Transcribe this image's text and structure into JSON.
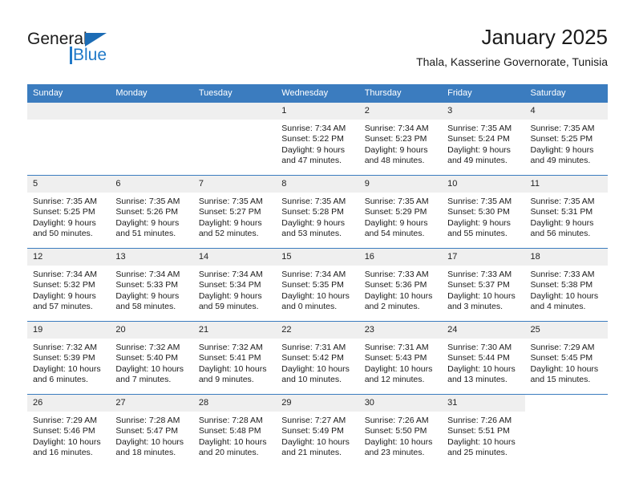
{
  "logo": {
    "word1": "General",
    "word2": "Blue",
    "triangle_color": "#1c6cb5",
    "blue_color": "#2079c8"
  },
  "header": {
    "title": "January 2025",
    "subtitle": "Thala, Kasserine Governorate, Tunisia"
  },
  "calendar": {
    "header_bg": "#3b7cbf",
    "daynum_bg": "#efefef",
    "weekdays": [
      "Sunday",
      "Monday",
      "Tuesday",
      "Wednesday",
      "Thursday",
      "Friday",
      "Saturday"
    ],
    "weeks": [
      [
        {
          "day": "",
          "lines": []
        },
        {
          "day": "",
          "lines": []
        },
        {
          "day": "",
          "lines": []
        },
        {
          "day": "1",
          "lines": [
            "Sunrise: 7:34 AM",
            "Sunset: 5:22 PM",
            "Daylight: 9 hours",
            "and 47 minutes."
          ]
        },
        {
          "day": "2",
          "lines": [
            "Sunrise: 7:34 AM",
            "Sunset: 5:23 PM",
            "Daylight: 9 hours",
            "and 48 minutes."
          ]
        },
        {
          "day": "3",
          "lines": [
            "Sunrise: 7:35 AM",
            "Sunset: 5:24 PM",
            "Daylight: 9 hours",
            "and 49 minutes."
          ]
        },
        {
          "day": "4",
          "lines": [
            "Sunrise: 7:35 AM",
            "Sunset: 5:25 PM",
            "Daylight: 9 hours",
            "and 49 minutes."
          ]
        }
      ],
      [
        {
          "day": "5",
          "lines": [
            "Sunrise: 7:35 AM",
            "Sunset: 5:25 PM",
            "Daylight: 9 hours",
            "and 50 minutes."
          ]
        },
        {
          "day": "6",
          "lines": [
            "Sunrise: 7:35 AM",
            "Sunset: 5:26 PM",
            "Daylight: 9 hours",
            "and 51 minutes."
          ]
        },
        {
          "day": "7",
          "lines": [
            "Sunrise: 7:35 AM",
            "Sunset: 5:27 PM",
            "Daylight: 9 hours",
            "and 52 minutes."
          ]
        },
        {
          "day": "8",
          "lines": [
            "Sunrise: 7:35 AM",
            "Sunset: 5:28 PM",
            "Daylight: 9 hours",
            "and 53 minutes."
          ]
        },
        {
          "day": "9",
          "lines": [
            "Sunrise: 7:35 AM",
            "Sunset: 5:29 PM",
            "Daylight: 9 hours",
            "and 54 minutes."
          ]
        },
        {
          "day": "10",
          "lines": [
            "Sunrise: 7:35 AM",
            "Sunset: 5:30 PM",
            "Daylight: 9 hours",
            "and 55 minutes."
          ]
        },
        {
          "day": "11",
          "lines": [
            "Sunrise: 7:35 AM",
            "Sunset: 5:31 PM",
            "Daylight: 9 hours",
            "and 56 minutes."
          ]
        }
      ],
      [
        {
          "day": "12",
          "lines": [
            "Sunrise: 7:34 AM",
            "Sunset: 5:32 PM",
            "Daylight: 9 hours",
            "and 57 minutes."
          ]
        },
        {
          "day": "13",
          "lines": [
            "Sunrise: 7:34 AM",
            "Sunset: 5:33 PM",
            "Daylight: 9 hours",
            "and 58 minutes."
          ]
        },
        {
          "day": "14",
          "lines": [
            "Sunrise: 7:34 AM",
            "Sunset: 5:34 PM",
            "Daylight: 9 hours",
            "and 59 minutes."
          ]
        },
        {
          "day": "15",
          "lines": [
            "Sunrise: 7:34 AM",
            "Sunset: 5:35 PM",
            "Daylight: 10 hours",
            "and 0 minutes."
          ]
        },
        {
          "day": "16",
          "lines": [
            "Sunrise: 7:33 AM",
            "Sunset: 5:36 PM",
            "Daylight: 10 hours",
            "and 2 minutes."
          ]
        },
        {
          "day": "17",
          "lines": [
            "Sunrise: 7:33 AM",
            "Sunset: 5:37 PM",
            "Daylight: 10 hours",
            "and 3 minutes."
          ]
        },
        {
          "day": "18",
          "lines": [
            "Sunrise: 7:33 AM",
            "Sunset: 5:38 PM",
            "Daylight: 10 hours",
            "and 4 minutes."
          ]
        }
      ],
      [
        {
          "day": "19",
          "lines": [
            "Sunrise: 7:32 AM",
            "Sunset: 5:39 PM",
            "Daylight: 10 hours",
            "and 6 minutes."
          ]
        },
        {
          "day": "20",
          "lines": [
            "Sunrise: 7:32 AM",
            "Sunset: 5:40 PM",
            "Daylight: 10 hours",
            "and 7 minutes."
          ]
        },
        {
          "day": "21",
          "lines": [
            "Sunrise: 7:32 AM",
            "Sunset: 5:41 PM",
            "Daylight: 10 hours",
            "and 9 minutes."
          ]
        },
        {
          "day": "22",
          "lines": [
            "Sunrise: 7:31 AM",
            "Sunset: 5:42 PM",
            "Daylight: 10 hours",
            "and 10 minutes."
          ]
        },
        {
          "day": "23",
          "lines": [
            "Sunrise: 7:31 AM",
            "Sunset: 5:43 PM",
            "Daylight: 10 hours",
            "and 12 minutes."
          ]
        },
        {
          "day": "24",
          "lines": [
            "Sunrise: 7:30 AM",
            "Sunset: 5:44 PM",
            "Daylight: 10 hours",
            "and 13 minutes."
          ]
        },
        {
          "day": "25",
          "lines": [
            "Sunrise: 7:29 AM",
            "Sunset: 5:45 PM",
            "Daylight: 10 hours",
            "and 15 minutes."
          ]
        }
      ],
      [
        {
          "day": "26",
          "lines": [
            "Sunrise: 7:29 AM",
            "Sunset: 5:46 PM",
            "Daylight: 10 hours",
            "and 16 minutes."
          ]
        },
        {
          "day": "27",
          "lines": [
            "Sunrise: 7:28 AM",
            "Sunset: 5:47 PM",
            "Daylight: 10 hours",
            "and 18 minutes."
          ]
        },
        {
          "day": "28",
          "lines": [
            "Sunrise: 7:28 AM",
            "Sunset: 5:48 PM",
            "Daylight: 10 hours",
            "and 20 minutes."
          ]
        },
        {
          "day": "29",
          "lines": [
            "Sunrise: 7:27 AM",
            "Sunset: 5:49 PM",
            "Daylight: 10 hours",
            "and 21 minutes."
          ]
        },
        {
          "day": "30",
          "lines": [
            "Sunrise: 7:26 AM",
            "Sunset: 5:50 PM",
            "Daylight: 10 hours",
            "and 23 minutes."
          ]
        },
        {
          "day": "31",
          "lines": [
            "Sunrise: 7:26 AM",
            "Sunset: 5:51 PM",
            "Daylight: 10 hours",
            "and 25 minutes."
          ]
        },
        {
          "day": "",
          "lines": []
        }
      ]
    ]
  }
}
